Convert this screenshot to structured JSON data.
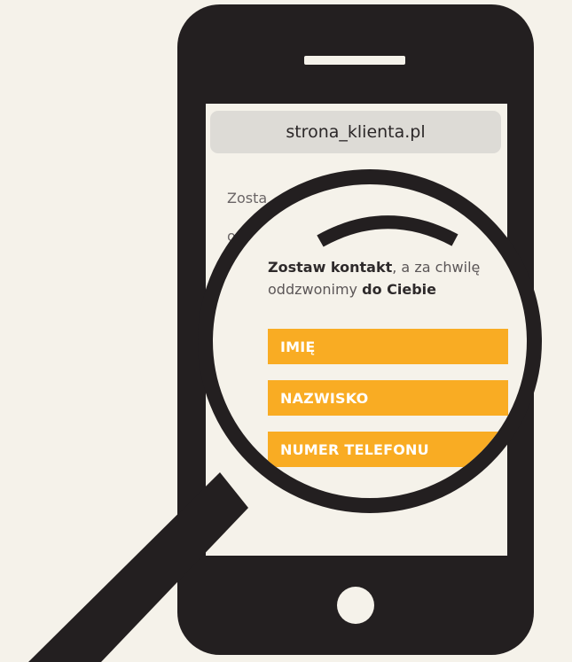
{
  "browser": {
    "url": "strona_klienta.pl"
  },
  "background_screen_text": {
    "line1": "Zosta",
    "line2": "o"
  },
  "lens": {
    "headline_bold": "Zostaw kontakt",
    "headline_rest": ", a za chwilę",
    "subline_normal": "oddzwonimy ",
    "subline_bold": "do Ciebie",
    "fields": {
      "first_name": "IMIĘ",
      "last_name": "NAZWISKO",
      "phone": "NUMER TELEFONU"
    }
  },
  "colors": {
    "background": "#f5f2ea",
    "phone": "#231f20",
    "url_bar": "#dddbd6",
    "accent": "#f9ac23"
  }
}
